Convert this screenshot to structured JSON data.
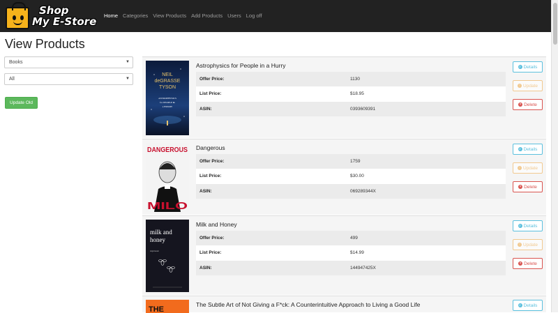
{
  "navbar": {
    "logo_line1": "Shop",
    "logo_line2": "My E-Store",
    "links": [
      "Home",
      "Categories",
      "View Products",
      "Add Products",
      "Users",
      "Log off"
    ]
  },
  "page_title": "View Products",
  "filters": {
    "category": "Books",
    "subcategory": "All",
    "update_old_label": "Update Old"
  },
  "labels": {
    "offer_price": "Offer Price:",
    "list_price": "List Price:",
    "asin": "ASIN:",
    "details": "Details",
    "update": "Update",
    "delete": "Delete"
  },
  "products": [
    {
      "title": "Astrophysics for People in a Hurry",
      "offer_price": "1130",
      "list_price": "$18.95",
      "asin": "0393609391",
      "cover": {
        "author_line1": "NEIL",
        "author_line2": "deGRASSE",
        "author_line3": "TYSON",
        "title_line1": "ASTROPHYSICS",
        "title_line2": "for PEOPLE in",
        "title_line3": "a HURRY"
      }
    },
    {
      "title": "Dangerous",
      "offer_price": "1759",
      "list_price": "$30.00",
      "asin": "069289344X",
      "cover": {
        "title": "DANGEROUS",
        "author": "MILO"
      }
    },
    {
      "title": "Milk and Honey",
      "offer_price": "499",
      "list_price": "$14.99",
      "asin": "144947425X",
      "cover": {
        "title_line1": "milk and",
        "title_line2": "honey",
        "author": "rupi kaur"
      }
    },
    {
      "title": "The Subtle Art of Not Giving a F*ck: A Counterintuitive Approach to Living a Good Life",
      "cover": {
        "title": "THE"
      }
    }
  ]
}
